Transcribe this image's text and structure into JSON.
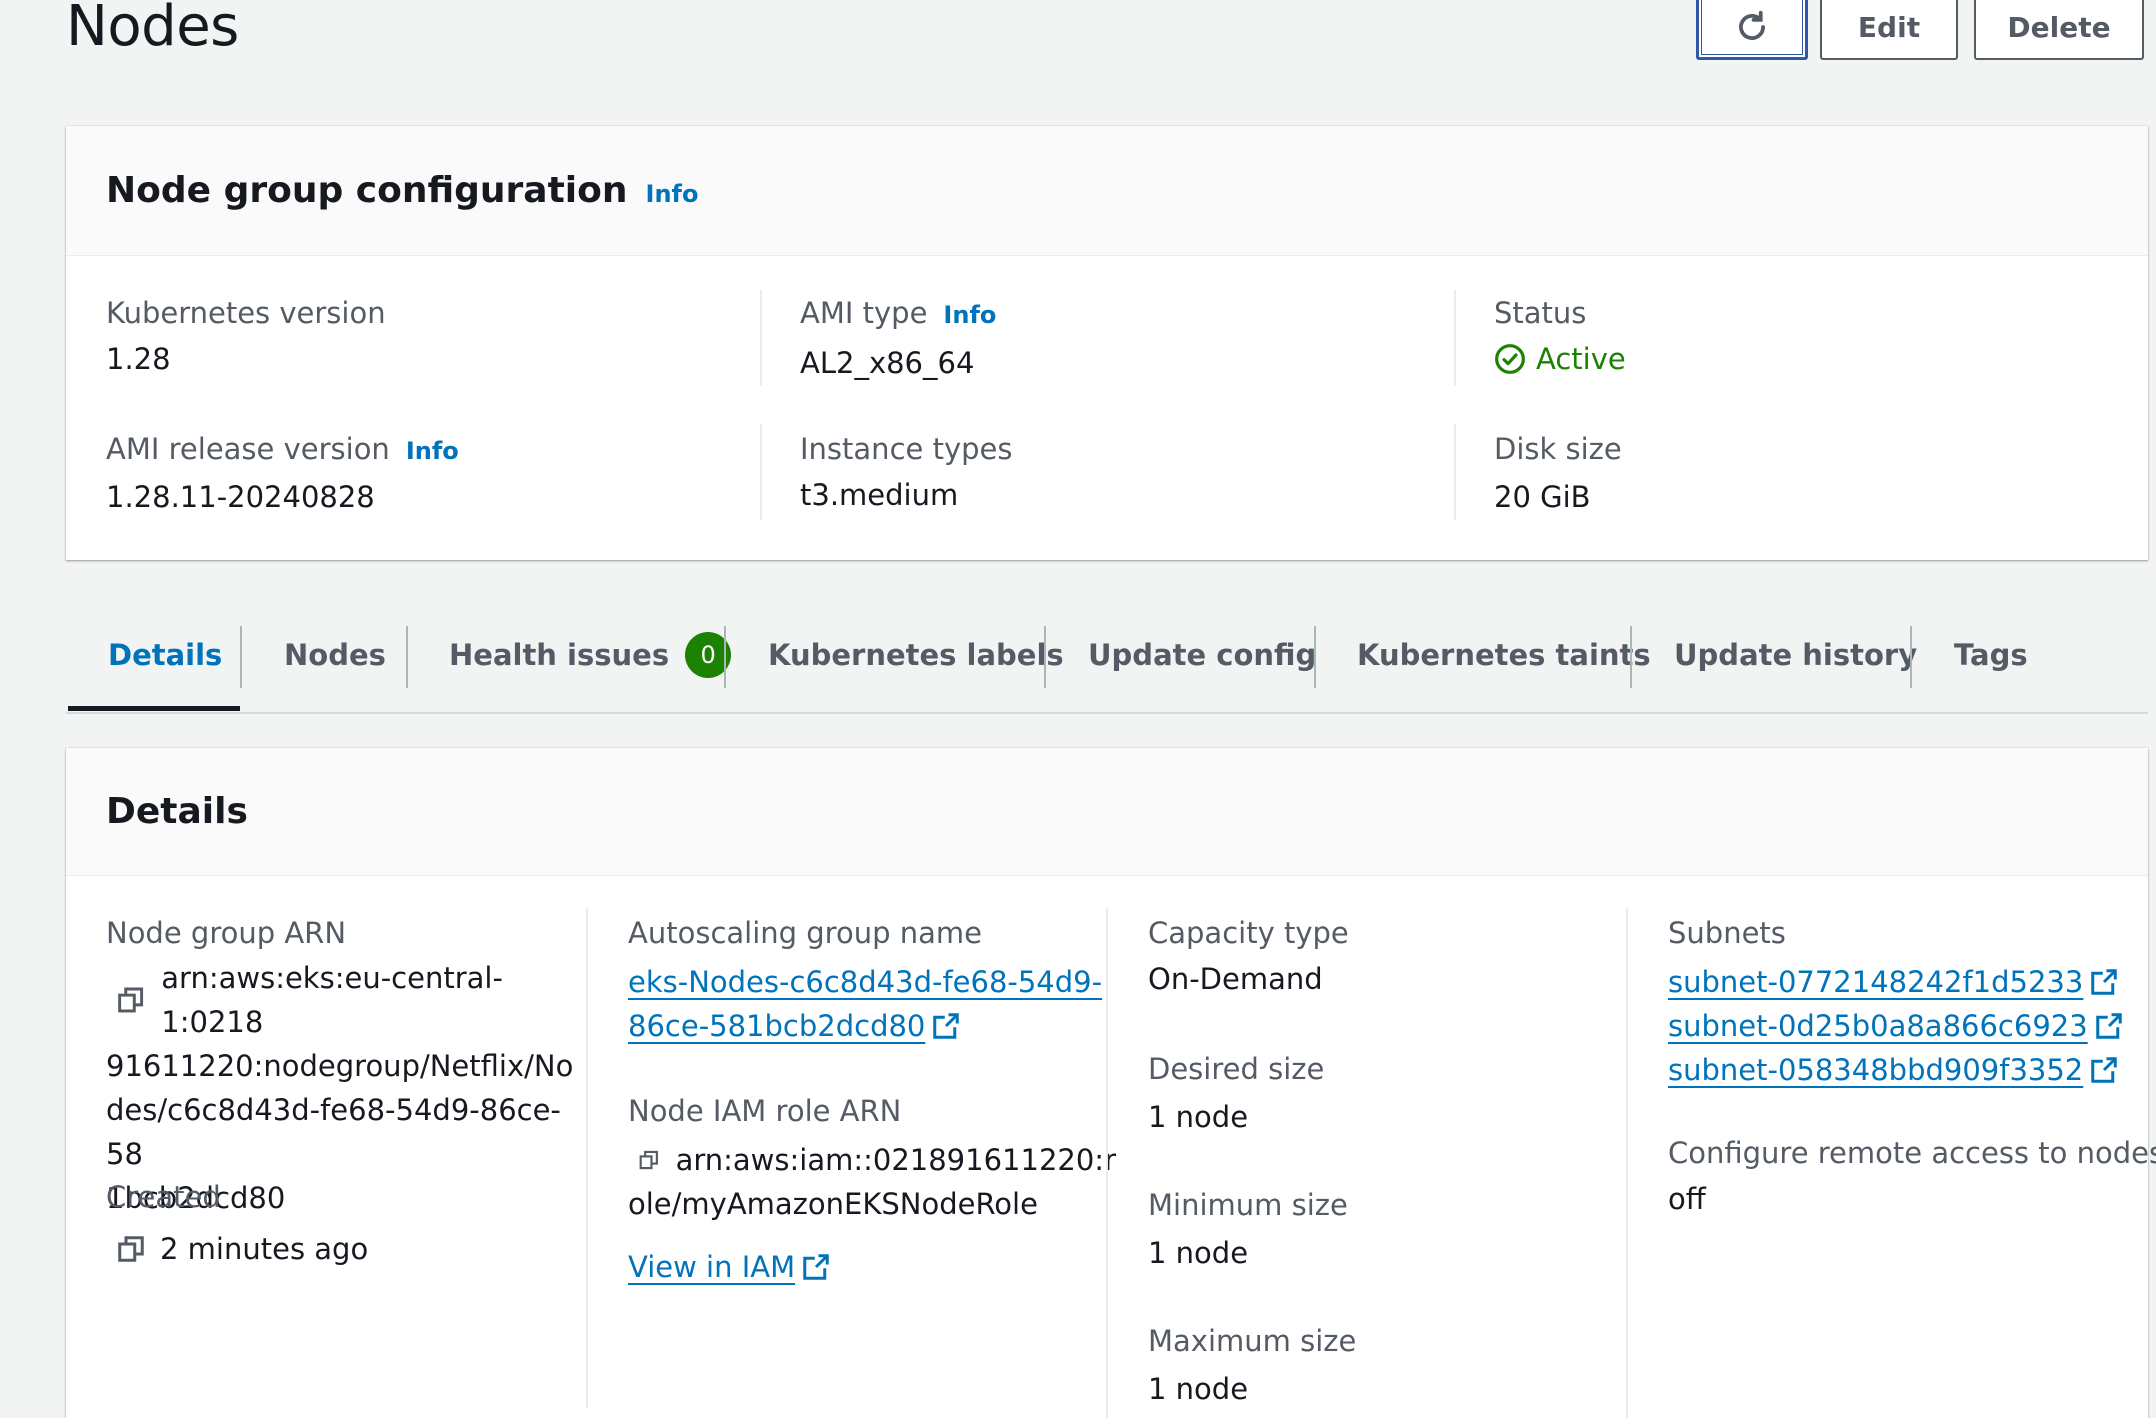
{
  "header": {
    "title": "Nodes",
    "buttons": {
      "refresh_icon": "refresh-icon",
      "edit": "Edit",
      "delete": "Delete"
    }
  },
  "config_panel": {
    "title": "Node group configuration",
    "info": "Info",
    "fields": {
      "k8s_version_label": "Kubernetes version",
      "k8s_version_value": "1.28",
      "ami_release_label": "AMI release version",
      "ami_release_value": "1.28.11-20240828",
      "ami_type_label": "AMI type",
      "ami_type_value": "AL2_x86_64",
      "instance_types_label": "Instance types",
      "instance_types_value": "t3.medium",
      "status_label": "Status",
      "status_value": "Active",
      "disk_size_label": "Disk size",
      "disk_size_value": "20 GiB"
    }
  },
  "tabs": [
    {
      "label": "Details",
      "active": true
    },
    {
      "label": "Nodes"
    },
    {
      "label": "Health issues",
      "badge": "0"
    },
    {
      "label": "Kubernetes labels"
    },
    {
      "label": "Update config"
    },
    {
      "label": "Kubernetes taints"
    },
    {
      "label": "Update history"
    },
    {
      "label": "Tags"
    }
  ],
  "details_panel": {
    "title": "Details",
    "node_group_arn_label": "Node group ARN",
    "node_group_arn_lines": [
      "arn:aws:eks:eu-central-1:0218",
      "91611220:nodegroup/Netflix/No",
      "des/c6c8d43d-fe68-54d9-86ce-58",
      "1bcb2dcd80"
    ],
    "created_label": "Created",
    "created_value": "2 minutes ago",
    "asg_label": "Autoscaling group name",
    "asg_lines": [
      "eks-Nodes-c6c8d43d-fe68-54d9-",
      "86ce-581bcb2dcd80"
    ],
    "iam_label": "Node IAM role ARN",
    "iam_lines": [
      "arn:aws:iam::021891611220:r",
      "ole/myAmazonEKSNodeRole"
    ],
    "view_iam": "View in IAM",
    "capacity_label": "Capacity type",
    "capacity_value": "On-Demand",
    "desired_label": "Desired size",
    "desired_value": "1 node",
    "min_label": "Minimum size",
    "min_value": "1 node",
    "max_label": "Maximum size",
    "max_value": "1 node",
    "subnets_label": "Subnets",
    "subnets": [
      "subnet-0772148242f1d5233",
      "subnet-0d25b0a8a866c6923",
      "subnet-058348bbd909f3352"
    ],
    "remote_label": "Configure remote access to nodes",
    "remote_value": "off"
  },
  "colors": {
    "link": "#0073bb",
    "success": "#1d8102",
    "text": "#16191f",
    "label": "#545b64",
    "background": "#f2f3f3"
  }
}
